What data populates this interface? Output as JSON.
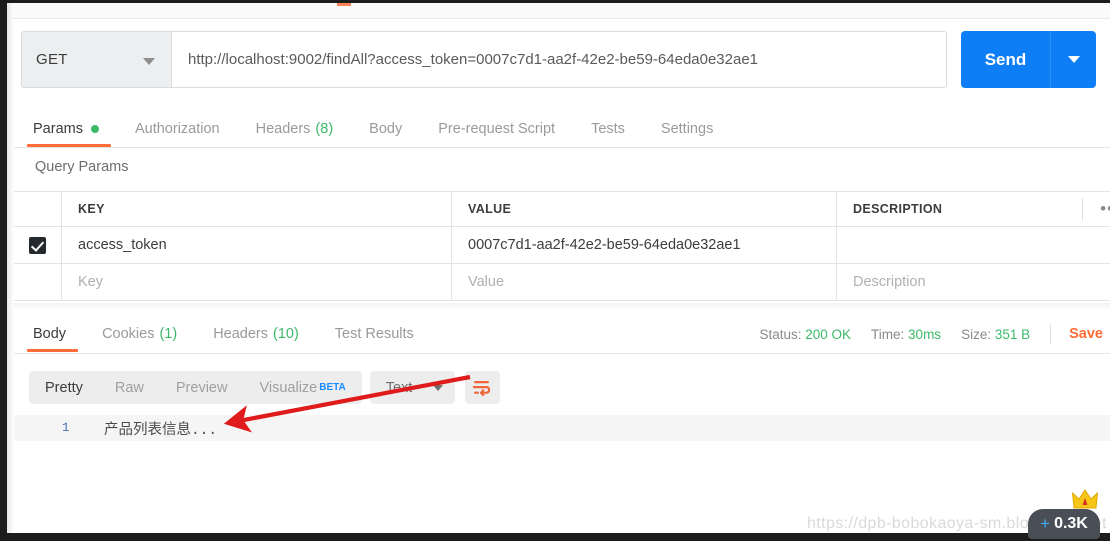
{
  "request": {
    "method": "GET",
    "method_caret": "chevron-down-icon",
    "url": "http://localhost:9002/findAll?access_token=0007c7d1-aa2f-42e2-be59-64eda0e32ae1",
    "send_label": "Send",
    "send_caret": "chevron-down-icon"
  },
  "request_tabs": [
    {
      "label": "Params",
      "badge": "",
      "dot": true,
      "active": true
    },
    {
      "label": "Authorization",
      "badge": "",
      "dot": false,
      "active": false
    },
    {
      "label": "Headers",
      "badge": "(8)",
      "dot": false,
      "active": false
    },
    {
      "label": "Body",
      "badge": "",
      "dot": false,
      "active": false
    },
    {
      "label": "Pre-request Script",
      "badge": "",
      "dot": false,
      "active": false
    },
    {
      "label": "Tests",
      "badge": "",
      "dot": false,
      "active": false
    },
    {
      "label": "Settings",
      "badge": "",
      "dot": false,
      "active": false
    }
  ],
  "query_params": {
    "title": "Query Params",
    "columns": [
      "KEY",
      "VALUE",
      "DESCRIPTION"
    ],
    "bulk_edit_icon": "ellipsis-icon",
    "rows": [
      {
        "checked": true,
        "key": "access_token",
        "value": "0007c7d1-aa2f-42e2-be59-64eda0e32ae1",
        "description": ""
      }
    ],
    "placeholder_row": {
      "key": "Key",
      "value": "Value",
      "description": "Description"
    }
  },
  "response_tabs": [
    {
      "label": "Body",
      "badge": "",
      "active": true
    },
    {
      "label": "Cookies",
      "badge": "(1)",
      "active": false
    },
    {
      "label": "Headers",
      "badge": "(10)",
      "active": false
    },
    {
      "label": "Test Results",
      "badge": "",
      "active": false
    }
  ],
  "response_meta": {
    "status_label": "Status:",
    "status_value": "200 OK",
    "time_label": "Time:",
    "time_value": "30ms",
    "size_label": "Size:",
    "size_value": "351 B",
    "save_label": "Save"
  },
  "body_toolbar": {
    "views": [
      {
        "label": "Pretty",
        "active": true
      },
      {
        "label": "Raw",
        "active": false
      },
      {
        "label": "Preview",
        "active": false
      },
      {
        "label": "Visualize",
        "active": false,
        "beta": "BETA"
      }
    ],
    "format": "Text",
    "format_caret": "chevron-down-icon",
    "wrap_icon": "word-wrap-icon"
  },
  "response_body": {
    "line_number": "1",
    "content": "产品列表信息..."
  },
  "annotation": {
    "arrow_icon": "red-arrow-annotation",
    "color": "#e01b1b"
  },
  "overlay": {
    "watermark": "https://dpb-bobokaoya-sm.blog.csdn.net",
    "counter_plus": "+",
    "counter_value": "0.3K",
    "crown_icon": "crown-icon"
  },
  "colors": {
    "accent_orange": "#ff6c37",
    "send_blue": "#0d7ef5",
    "success_green": "#3db96a",
    "beta_blue": "#1a8cff"
  }
}
